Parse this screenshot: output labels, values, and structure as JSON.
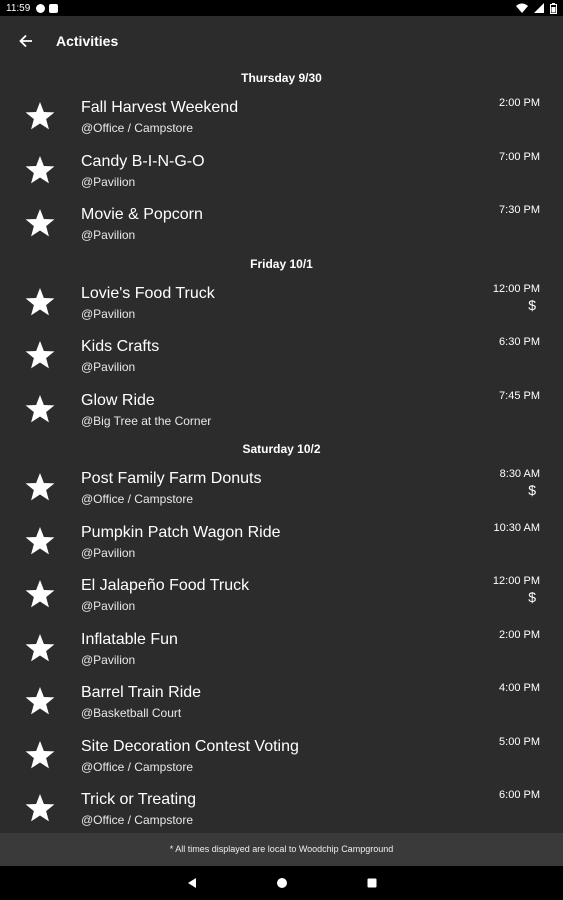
{
  "status_bar": {
    "time": "11:59"
  },
  "app_bar": {
    "title": "Activities"
  },
  "days": [
    {
      "header": "Thursday 9/30",
      "events": [
        {
          "name": "Fall Harvest Weekend",
          "location": "@Office / Campstore",
          "time": "2:00 PM",
          "cost": ""
        },
        {
          "name": "Candy B-I-N-G-O",
          "location": "@Pavilion",
          "time": "7:00 PM",
          "cost": ""
        },
        {
          "name": "Movie & Popcorn",
          "location": "@Pavilion",
          "time": "7:30 PM",
          "cost": ""
        }
      ]
    },
    {
      "header": "Friday 10/1",
      "events": [
        {
          "name": "Lovie's Food Truck",
          "location": "@Pavilion",
          "time": "12:00 PM",
          "cost": "$"
        },
        {
          "name": "Kids Crafts",
          "location": "@Pavilion",
          "time": "6:30 PM",
          "cost": ""
        },
        {
          "name": "Glow Ride",
          "location": "@Big Tree at the Corner",
          "time": "7:45 PM",
          "cost": ""
        }
      ]
    },
    {
      "header": "Saturday 10/2",
      "events": [
        {
          "name": "Post Family Farm Donuts",
          "location": "@Office / Campstore",
          "time": "8:30 AM",
          "cost": "$"
        },
        {
          "name": "Pumpkin Patch Wagon Ride",
          "location": "@Pavilion",
          "time": "10:30 AM",
          "cost": ""
        },
        {
          "name": "El Jalapeño Food Truck",
          "location": "@Pavilion",
          "time": "12:00 PM",
          "cost": "$"
        },
        {
          "name": "Inflatable Fun",
          "location": "@Pavilion",
          "time": "2:00 PM",
          "cost": ""
        },
        {
          "name": "Barrel Train Ride",
          "location": "@Basketball Court",
          "time": "4:00 PM",
          "cost": ""
        },
        {
          "name": "Site Decoration Contest Voting",
          "location": "@Office / Campstore",
          "time": "5:00 PM",
          "cost": ""
        },
        {
          "name": "Trick or Treating",
          "location": "@Office / Campstore",
          "time": "6:00 PM",
          "cost": ""
        }
      ]
    }
  ],
  "footer": {
    "note": "* All times displayed are local to Woodchip Campground"
  },
  "colors": {
    "background": "#2c2c2c",
    "footer_background": "#3a3a3a",
    "text": "#ffffff"
  }
}
